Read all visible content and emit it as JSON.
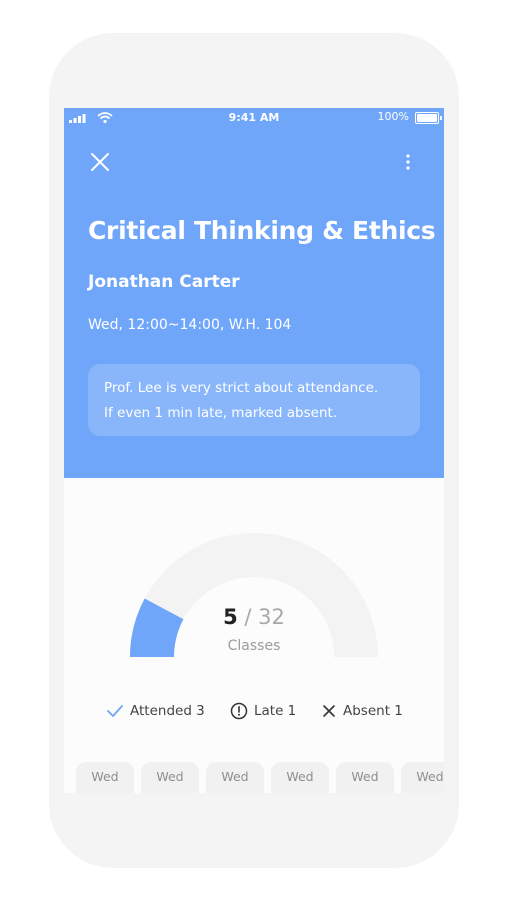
{
  "status_bar": {
    "time": "9:41 AM",
    "battery": "100%"
  },
  "header": {
    "course_title": "Critical Thinking & Ethics",
    "professor": "Jonathan Carter",
    "schedule": "Wed, 12:00~14:00, W.H. 104",
    "note_line1": "Prof. Lee is very strict about attendance.",
    "note_line2": "If even 1 min late, marked absent."
  },
  "attendance": {
    "attended_count": "5",
    "separator": "/",
    "total": "32",
    "label": "Classes",
    "progress_fraction": 0.15625
  },
  "legend": {
    "attended": "Attended 3",
    "late": "Late 1",
    "absent": "Absent 1"
  },
  "dates": [
    "Wed",
    "Wed",
    "Wed",
    "Wed",
    "Wed",
    "Wed"
  ],
  "colors": {
    "accent": "#6fa6f9",
    "track": "#f3f3f3",
    "background": "#fcfcfc"
  },
  "icons": [
    "close-icon",
    "more-vertical-icon",
    "signal-icon",
    "wifi-icon",
    "battery-icon",
    "check-icon",
    "late-clock-icon",
    "absent-x-icon"
  ]
}
